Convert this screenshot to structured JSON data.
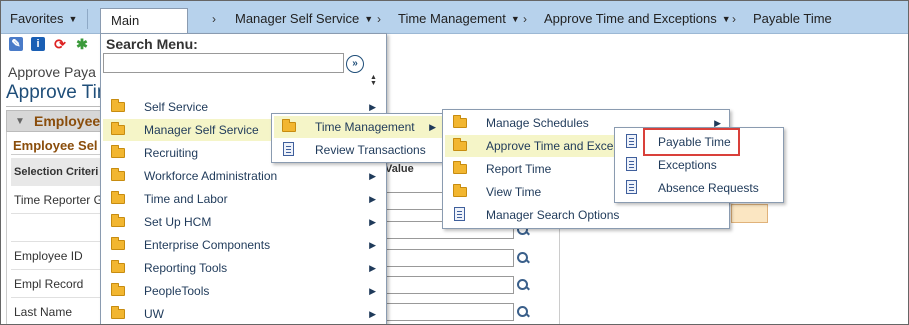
{
  "navbar": {
    "favorites": "Favorites",
    "main_menu": "Main Menu",
    "crumbs": [
      "Manager Self Service",
      "Time Management",
      "Approve Time and Exceptions",
      "Payable Time"
    ],
    "separator": "›"
  },
  "background": {
    "crumb": "Approve Paya",
    "title": "Approve Tim",
    "section": "Employee",
    "subsection": "Employee Sel",
    "col_header": "Selection Criteri",
    "value_header": "Value",
    "rows": [
      "Time Reporter G",
      "Employee ID",
      "Empl Record",
      "Last Name"
    ]
  },
  "search": {
    "label": "Search Menu:",
    "value": "",
    "placeholder": ""
  },
  "main_menu_items": [
    {
      "label": "Self Service",
      "icon": "folder-icon",
      "arrow": true,
      "selected": false
    },
    {
      "label": "Manager Self Service",
      "icon": "folder-icon",
      "arrow": true,
      "selected": true
    },
    {
      "label": "Recruiting",
      "icon": "folder-icon",
      "arrow": true,
      "selected": false
    },
    {
      "label": "Workforce Administration",
      "icon": "folder-icon",
      "arrow": true,
      "selected": false
    },
    {
      "label": "Time and Labor",
      "icon": "folder-icon",
      "arrow": true,
      "selected": false
    },
    {
      "label": "Set Up HCM",
      "icon": "folder-icon",
      "arrow": true,
      "selected": false
    },
    {
      "label": "Enterprise Components",
      "icon": "folder-icon",
      "arrow": true,
      "selected": false
    },
    {
      "label": "Reporting Tools",
      "icon": "folder-icon",
      "arrow": true,
      "selected": false
    },
    {
      "label": "PeopleTools",
      "icon": "folder-icon",
      "arrow": true,
      "selected": false
    },
    {
      "label": "UW",
      "icon": "folder-icon",
      "arrow": true,
      "selected": false
    }
  ],
  "mss_menu_items": [
    {
      "label": "Time Management",
      "icon": "folder-icon",
      "arrow": true,
      "selected": true
    },
    {
      "label": "Review Transactions",
      "icon": "document-icon",
      "arrow": false,
      "selected": false
    }
  ],
  "tm_menu_items": [
    {
      "label": "Manage Schedules",
      "icon": "folder-icon",
      "arrow": true,
      "selected": false
    },
    {
      "label": "Approve Time and Exce",
      "icon": "folder-icon",
      "arrow": false,
      "selected": true
    },
    {
      "label": "Report Time",
      "icon": "folder-icon",
      "arrow": false,
      "selected": false
    },
    {
      "label": "View Time",
      "icon": "folder-icon",
      "arrow": false,
      "selected": false
    },
    {
      "label": "Manager Search Options",
      "icon": "document-icon",
      "arrow": false,
      "selected": false
    }
  ],
  "ate_menu_items": [
    {
      "label": "Payable Time",
      "icon": "document-icon",
      "highlighted": true
    },
    {
      "label": "Exceptions",
      "icon": "document-icon",
      "highlighted": false
    },
    {
      "label": "Absence Requests",
      "icon": "document-icon",
      "highlighted": false
    }
  ],
  "colors": {
    "navbar": "#b7d2ec",
    "selected_item": "#f5f5c8",
    "highlight_border": "#d9403a",
    "menu_text": "#1f3a5a",
    "title_text": "#1f4e79"
  }
}
